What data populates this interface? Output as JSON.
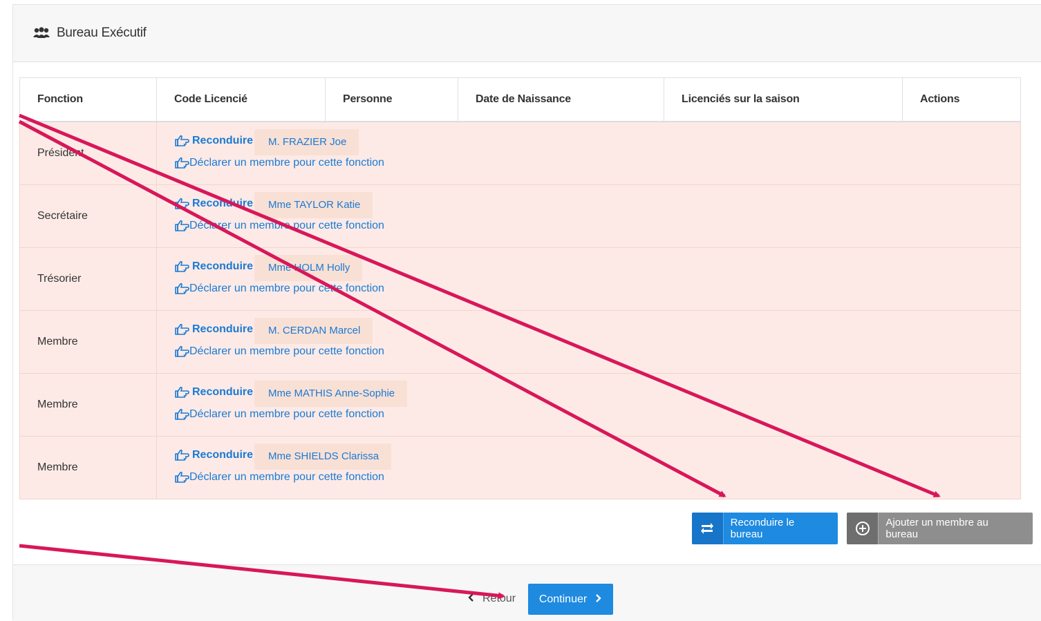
{
  "panel": {
    "title": "Bureau Exécutif"
  },
  "table": {
    "headers": [
      "Fonction",
      "Code Licencié",
      "Personne",
      "Date de Naissance",
      "Licenciés sur la saison",
      "Actions"
    ],
    "reconduire_label": "Reconduire",
    "declare_label": "Déclarer un membre pour cette fonction",
    "rows": [
      {
        "fonction": "Président",
        "person": "M. FRAZIER Joe"
      },
      {
        "fonction": "Secrétaire",
        "person": "Mme TAYLOR Katie"
      },
      {
        "fonction": "Trésorier",
        "person": "Mme HOLM Holly"
      },
      {
        "fonction": "Membre",
        "person": "M. CERDAN Marcel"
      },
      {
        "fonction": "Membre",
        "person": "Mme MATHIS Anne-Sophie"
      },
      {
        "fonction": "Membre",
        "person": "Mme SHIELDS Clarissa"
      }
    ]
  },
  "buttons": {
    "reconduire_bureau": "Reconduire le bureau",
    "ajouter_membre": "Ajouter un membre au bureau",
    "retour": "Retour",
    "continuer": "Continuer"
  },
  "colors": {
    "row_bg": "#fdeae6",
    "link_blue": "#1a7ad4",
    "primary_button": "#1e8ae0",
    "secondary_button": "#8e8e8e",
    "annotation_arrow": "#d8175a"
  },
  "icons": {
    "title": "users-group-icon",
    "reconduire": "hand-point-right-icon",
    "reconduire_bureau": "exchange-icon",
    "ajouter": "plus-circle-icon",
    "retour": "chevron-left-icon",
    "continuer": "chevron-right-icon"
  }
}
